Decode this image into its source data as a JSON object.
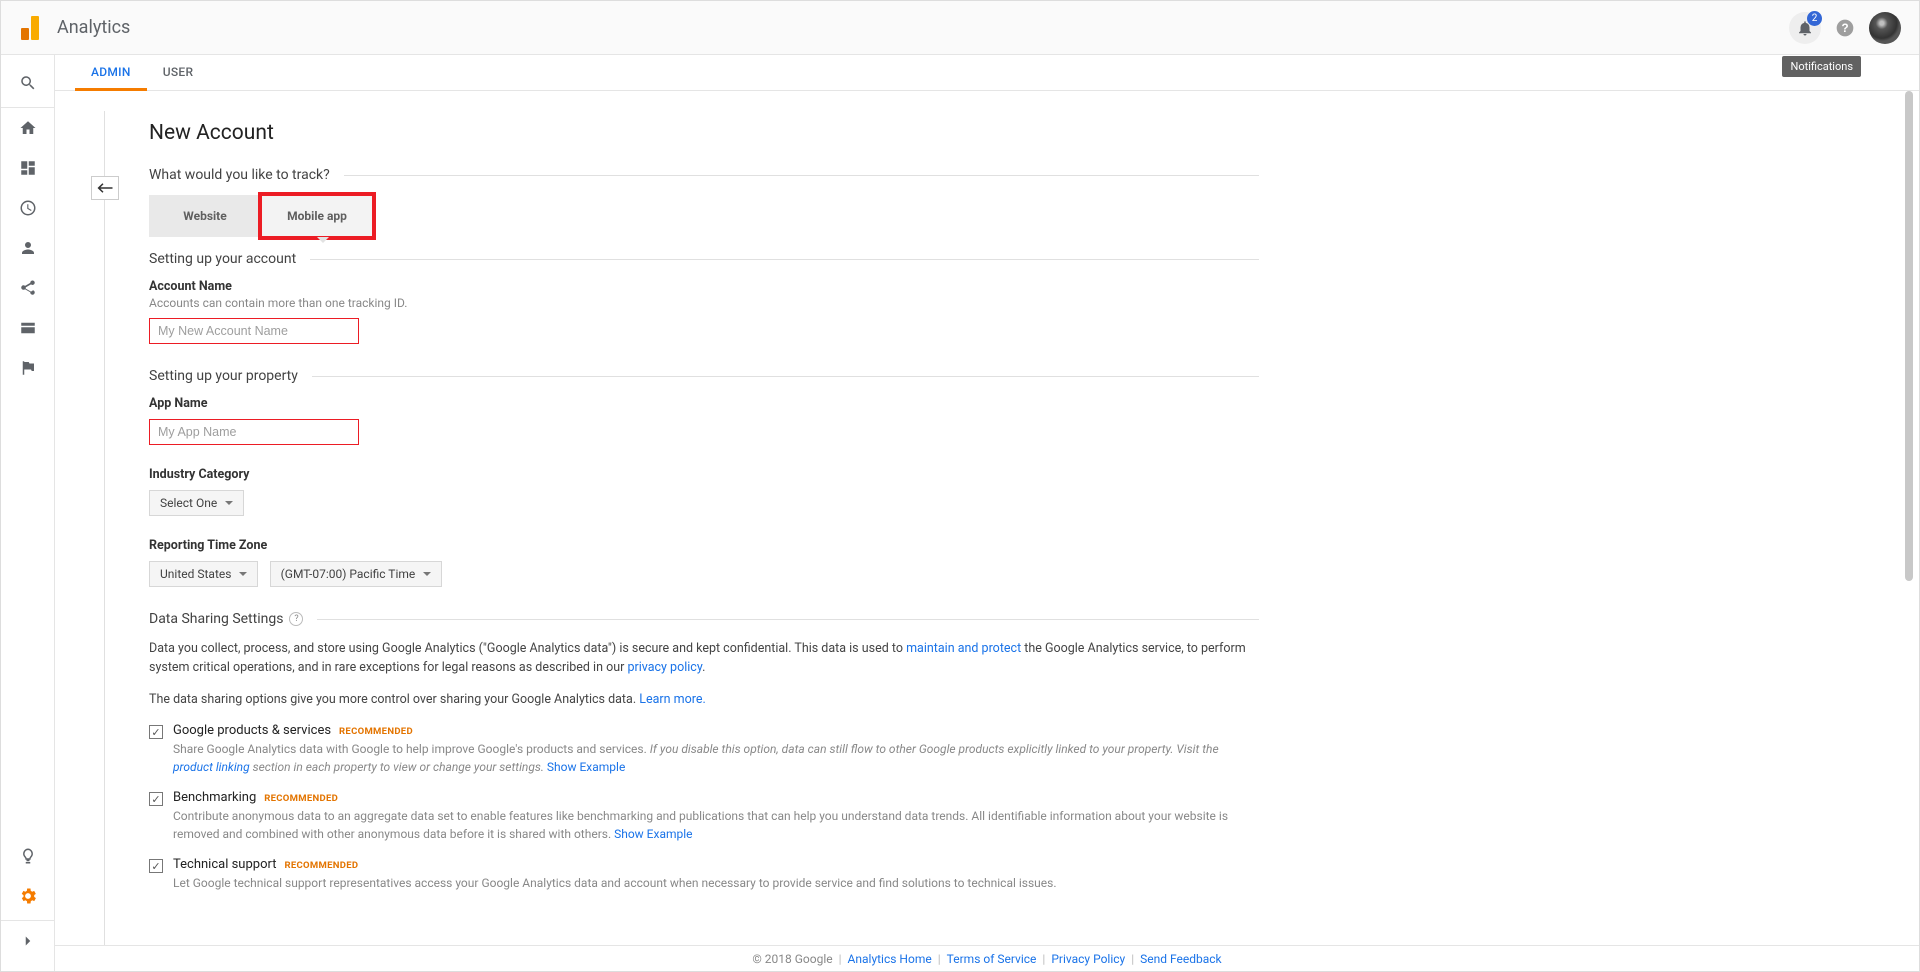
{
  "header": {
    "product": "Analytics",
    "notification_count": "2",
    "notifications_tooltip": "Notifications"
  },
  "tabs": {
    "admin": "ADMIN",
    "user": "USER"
  },
  "back_glyph": "↤",
  "page_title": "New Account",
  "track_section": {
    "heading": "What would you like to track?",
    "website": "Website",
    "mobile": "Mobile app"
  },
  "account": {
    "heading": "Setting up your account",
    "name_label": "Account Name",
    "name_hint": "Accounts can contain more than one tracking ID.",
    "name_placeholder": "My New Account Name"
  },
  "property": {
    "heading": "Setting up your property",
    "app_label": "App Name",
    "app_placeholder": "My App Name",
    "industry_label": "Industry Category",
    "industry_value": "Select One",
    "tz_label": "Reporting Time Zone",
    "tz_country": "United States",
    "tz_zone": "(GMT-07:00) Pacific Time"
  },
  "sharing": {
    "heading": "Data Sharing Settings",
    "intro_a": "Data you collect, process, and store using Google Analytics (\"Google Analytics data\") is secure and kept confidential. This data is used to ",
    "intro_link1": "maintain and protect",
    "intro_b": " the Google Analytics service, to perform system critical operations, and in rare exceptions for legal reasons as described in our ",
    "intro_link2": "privacy policy",
    "intro_c": ".",
    "control": "The data sharing options give you more control over sharing your Google Analytics data. ",
    "learn_more": "Learn more.",
    "recommended": "RECOMMENDED",
    "show_example": "Show Example",
    "opt1": {
      "title": "Google products & services",
      "desc_a": "Share Google Analytics data with Google to help improve Google's products and services. ",
      "desc_italic": "If you disable this option, data can still flow to other Google products explicitly linked to your property. Visit the ",
      "desc_link": "product linking",
      "desc_italic_b": " section in each property to view or change your settings. "
    },
    "opt2": {
      "title": "Benchmarking",
      "desc": "Contribute anonymous data to an aggregate data set to enable features like benchmarking and publications that can help you understand data trends. All identifiable information about your website is removed and combined with other anonymous data before it is shared with others. "
    },
    "opt3": {
      "title": "Technical support",
      "desc": "Let Google technical support representatives access your Google Analytics data and account when necessary to provide service and find solutions to technical issues."
    }
  },
  "footer": {
    "copyright": "© 2018 Google",
    "home": "Analytics Home",
    "tos": "Terms of Service",
    "privacy": "Privacy Policy",
    "feedback": "Send Feedback"
  }
}
